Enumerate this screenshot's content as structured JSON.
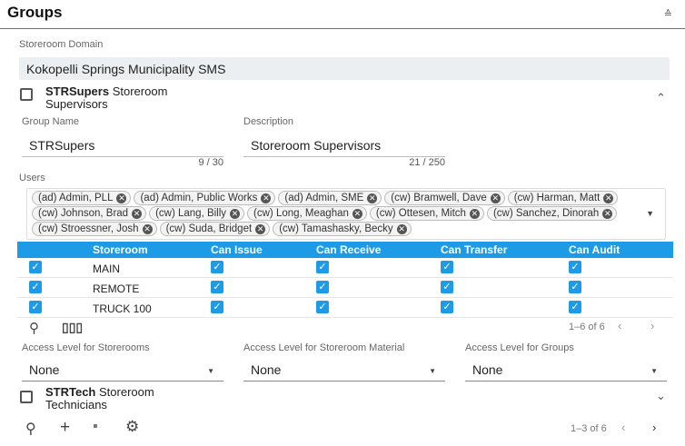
{
  "header": {
    "title": "Groups",
    "collapse_glyph": "≙"
  },
  "domain": {
    "label": "Storeroom Domain",
    "value": "Kokopelli Springs Municipality SMS"
  },
  "group1": {
    "name": "STRSupers",
    "description_line1": "Storeroom",
    "description_line2": "Supervisors",
    "expanded": true,
    "group_name_label": "Group Name",
    "group_name_value": "STRSupers",
    "group_name_counter": "9 / 30",
    "description_label": "Description",
    "description_value": "Storeroom Supervisors",
    "description_counter": "21 / 250",
    "users_label": "Users",
    "users": [
      "(ad) Admin, PLL",
      "(ad) Admin, Public Works",
      "(ad) Admin, SME",
      "(cw) Bramwell, Dave",
      "(cw) Harman, Matt",
      "(cw) Johnson, Brad",
      "(cw) Lang, Billy",
      "(cw) Long, Meaghan",
      "(cw) Ottesen, Mitch",
      "(cw) Sanchez, Dinorah",
      "(cw) Stroessner, Josh",
      "(cw) Suda, Bridget",
      "(cw) Tamashasky, Becky"
    ],
    "table": {
      "columns": [
        "Storeroom",
        "Can Issue",
        "Can Receive",
        "Can Transfer",
        "Can Audit"
      ],
      "rows": [
        {
          "storeroom": "MAIN",
          "selected": true,
          "can_issue": true,
          "can_receive": true,
          "can_transfer": true,
          "can_audit": true
        },
        {
          "storeroom": "REMOTE",
          "selected": true,
          "can_issue": true,
          "can_receive": true,
          "can_transfer": true,
          "can_audit": true
        },
        {
          "storeroom": "TRUCK 100",
          "selected": true,
          "can_issue": true,
          "can_receive": true,
          "can_transfer": true,
          "can_audit": true
        }
      ],
      "pager": "1–6 of 6"
    },
    "access": [
      {
        "label": "Access Level for Storerooms",
        "value": "None"
      },
      {
        "label": "Access Level for Storeroom Material",
        "value": "None"
      },
      {
        "label": "Access Level for Groups",
        "value": "None"
      }
    ]
  },
  "group2": {
    "name": "STRTech",
    "description_line1": "Storeroom",
    "description_line2": "Technicians",
    "expanded": false
  },
  "footer": {
    "pager": "1–3 of 6"
  },
  "icons": {
    "check": "✓",
    "chip_remove": "✕",
    "chevron_up": "⌃",
    "chevron_down": "⌄",
    "prev": "‹",
    "next": "›"
  },
  "colors": {
    "accent": "#1e9be6",
    "header_rule": "#1e88c8"
  }
}
